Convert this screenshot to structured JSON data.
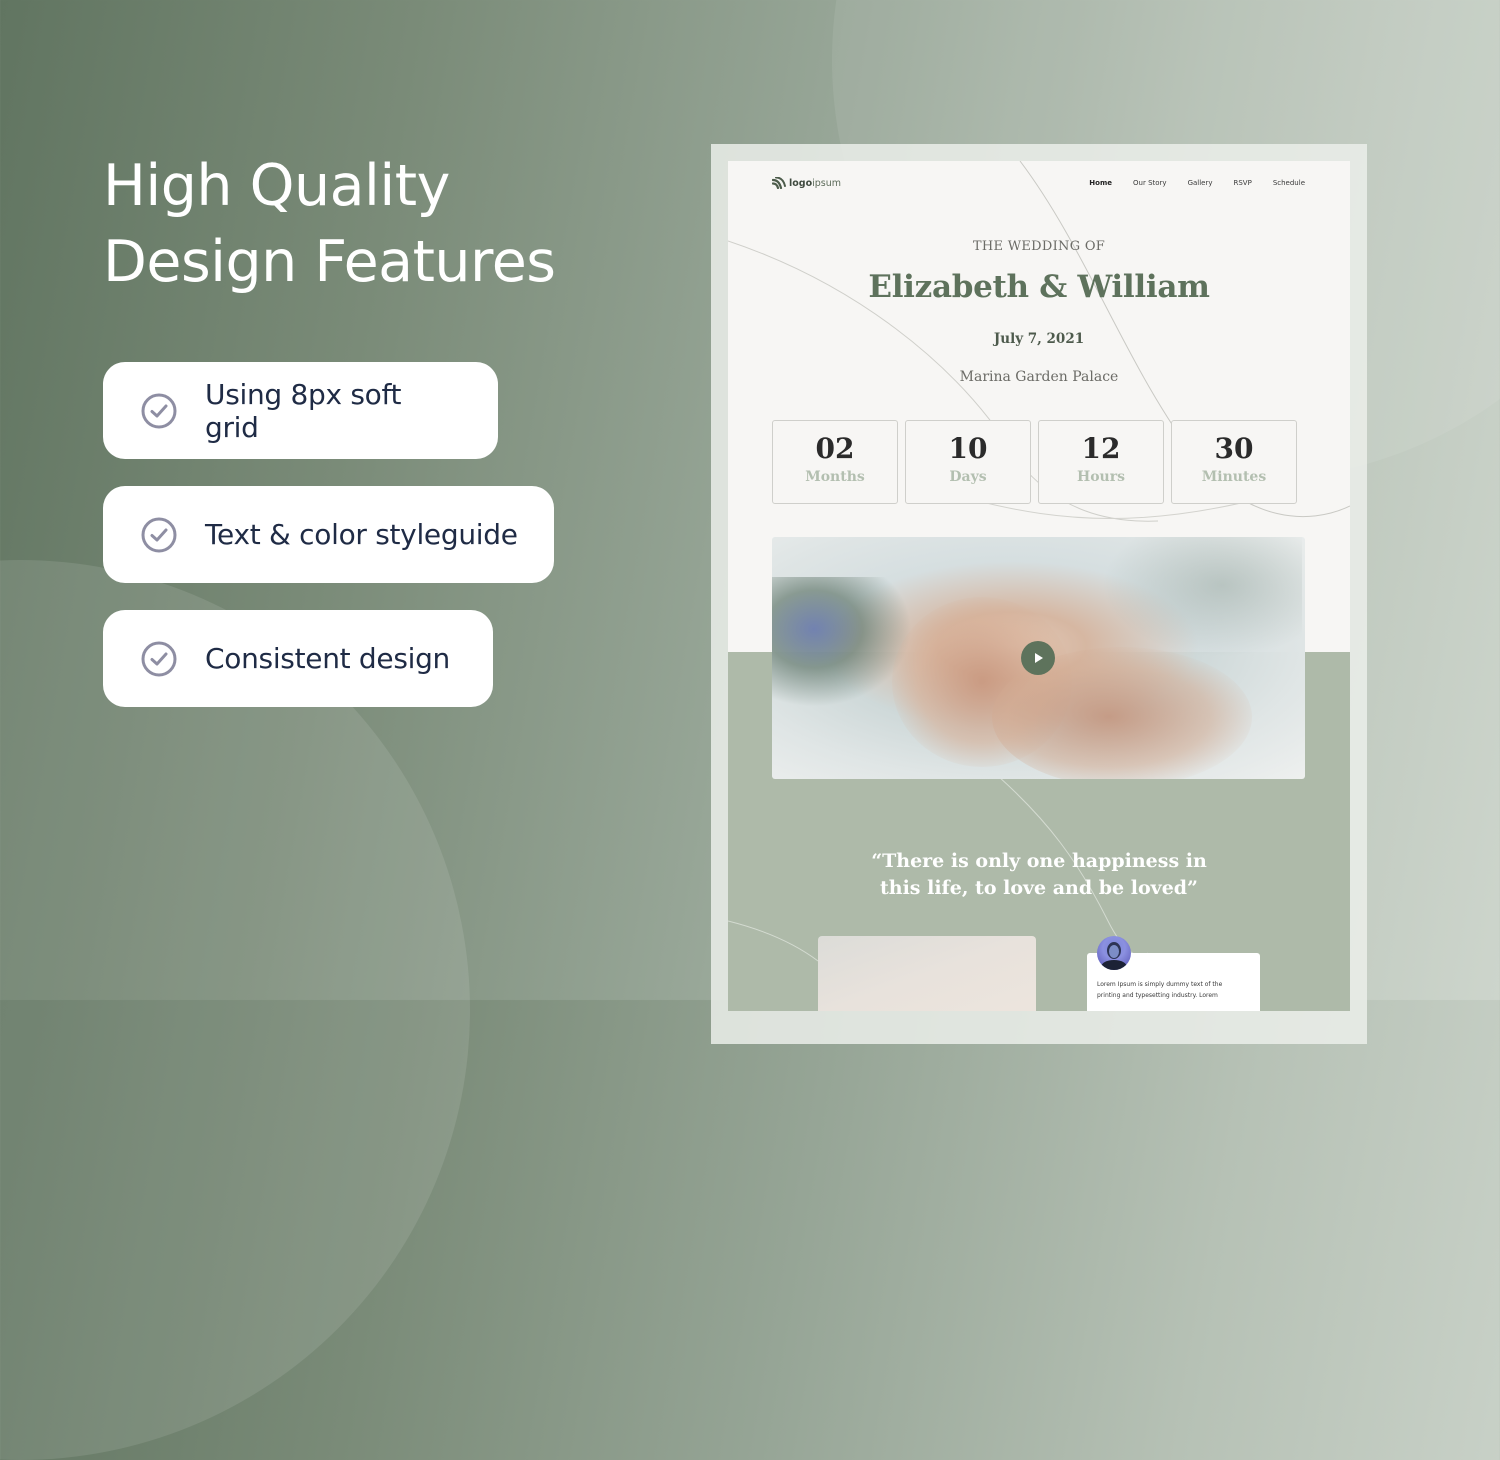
{
  "headline": {
    "line1": "High Quality",
    "line2": "Design Features"
  },
  "features": [
    {
      "icon": "check-circle-icon",
      "label": "Using 8px soft grid"
    },
    {
      "icon": "check-circle-icon",
      "label": "Text & color styleguide"
    },
    {
      "icon": "check-circle-icon",
      "label": "Consistent design"
    }
  ],
  "mockup": {
    "logo": {
      "bold": "logo",
      "rest": "ipsum",
      "icon": "logo-waves-icon"
    },
    "nav": [
      {
        "label": "Home",
        "active": true
      },
      {
        "label": "Our Story",
        "active": false
      },
      {
        "label": "Gallery",
        "active": false
      },
      {
        "label": "RSVP",
        "active": false
      },
      {
        "label": "Schedule",
        "active": false
      }
    ],
    "eyebrow": "THE WEDDING OF",
    "names": "Elizabeth & William",
    "date": "July 7, 2021",
    "venue": "Marina Garden Palace",
    "countdown": [
      {
        "value": "02",
        "unit": "Months"
      },
      {
        "value": "10",
        "unit": "Days"
      },
      {
        "value": "12",
        "unit": "Hours"
      },
      {
        "value": "30",
        "unit": "Minutes"
      }
    ],
    "video": {
      "icon": "play-icon"
    },
    "quote_line1": "“There is only one happiness in",
    "quote_line2": "this life, to love and be loved”",
    "testimonial": {
      "text": "Lorem Ipsum is simply dummy text of the printing and typesetting industry. Lorem"
    }
  },
  "colors": {
    "brand_green": "#5e725c",
    "sage": "#aebaa9",
    "page_bg": "#f7f6f4",
    "feature_text": "#1f2b45",
    "check_icon": "#8e8ea3"
  }
}
